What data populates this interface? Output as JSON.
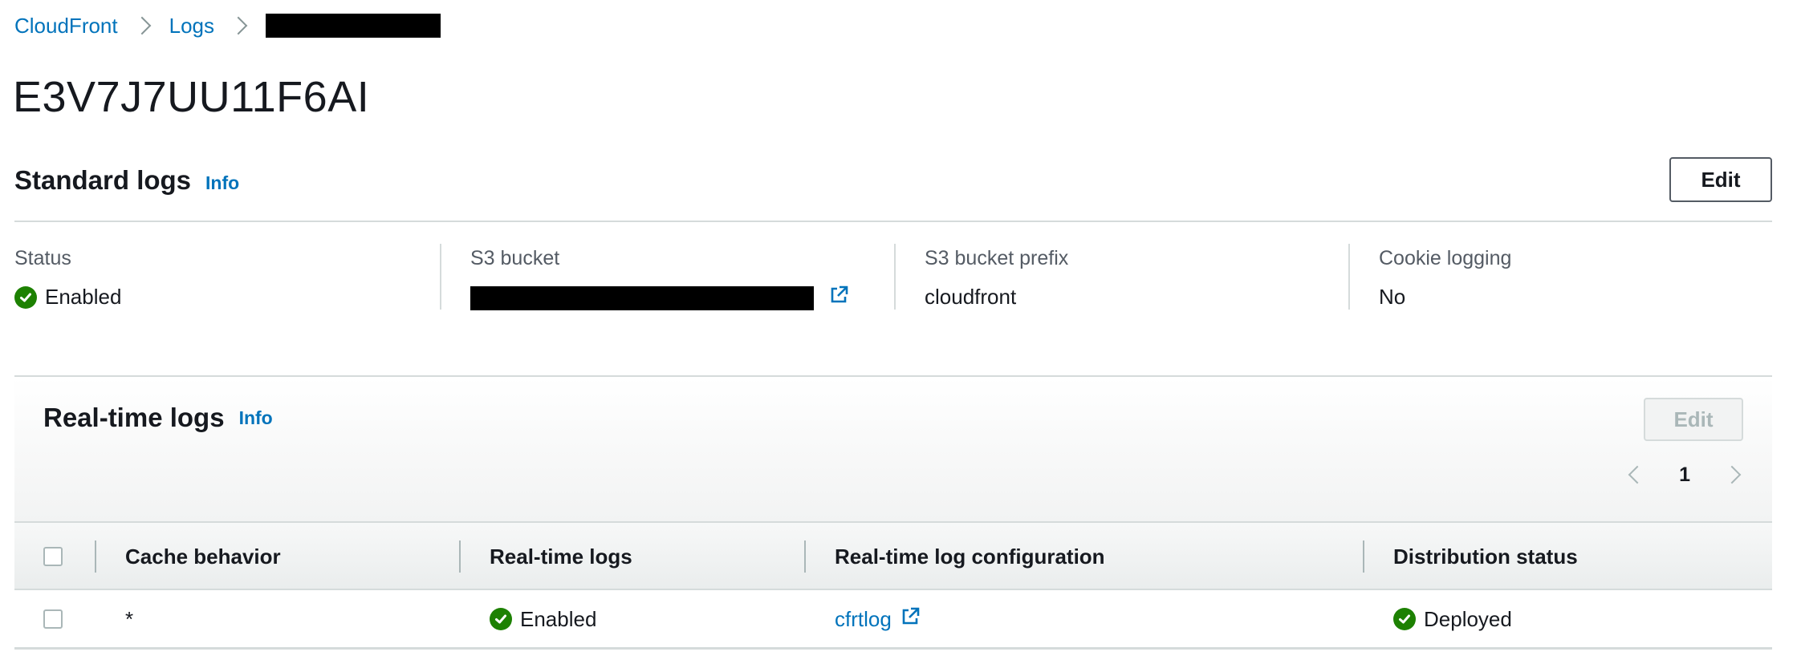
{
  "breadcrumb": {
    "items": [
      {
        "label": "CloudFront"
      },
      {
        "label": "Logs"
      }
    ]
  },
  "page": {
    "title": "E3V7J7UU11F6AI"
  },
  "standard_logs": {
    "title": "Standard logs",
    "info_label": "Info",
    "edit_label": "Edit",
    "fields": {
      "status": {
        "label": "Status",
        "value": "Enabled"
      },
      "s3_bucket": {
        "label": "S3 bucket",
        "value": ""
      },
      "s3_bucket_prefix": {
        "label": "S3 bucket prefix",
        "value": "cloudfront"
      },
      "cookie_logging": {
        "label": "Cookie logging",
        "value": "No"
      }
    }
  },
  "realtime_logs": {
    "title": "Real-time logs",
    "info_label": "Info",
    "edit_label": "Edit",
    "pagination": {
      "current_page": "1"
    },
    "columns": {
      "cache_behavior": "Cache behavior",
      "realtime_logs": "Real-time logs",
      "config": "Real-time log configuration",
      "distribution_status": "Distribution status"
    },
    "rows": [
      {
        "cache_behavior": "*",
        "realtime_logs": "Enabled",
        "config": "cfrtlog",
        "distribution_status": "Deployed"
      }
    ]
  },
  "colors": {
    "link": "#0073bb",
    "success": "#1d8102",
    "text": "#16191f",
    "muted": "#545b64",
    "border": "#d5dbdb"
  },
  "icons": [
    "chevron-right-icon",
    "status-success-icon",
    "external-link-icon",
    "chevron-left-icon"
  ]
}
